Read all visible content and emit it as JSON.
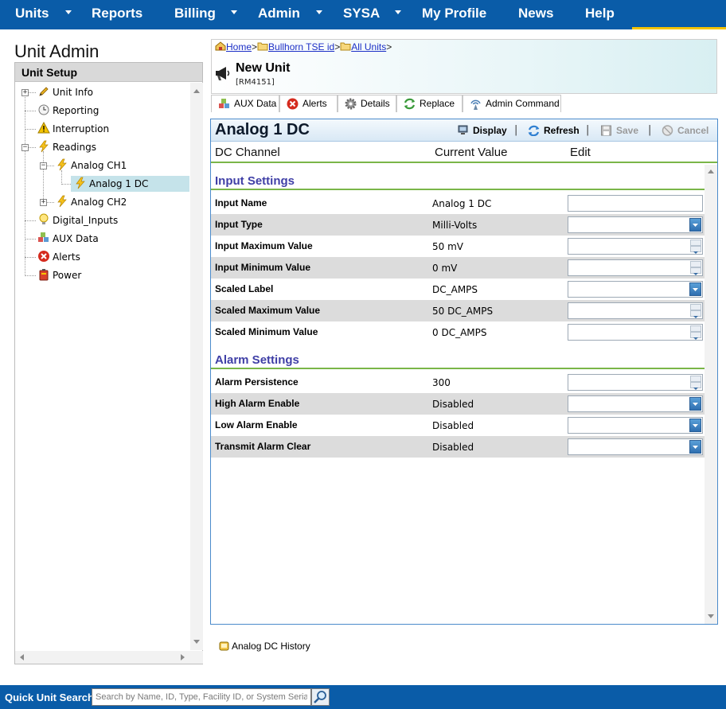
{
  "nav": {
    "items": [
      {
        "label": "Units",
        "has_menu": true
      },
      {
        "label": "Reports",
        "has_menu": false
      },
      {
        "label": "Billing",
        "has_menu": true
      },
      {
        "label": "Admin",
        "has_menu": true
      },
      {
        "label": "SYSA",
        "has_menu": true
      },
      {
        "label": "My Profile",
        "has_menu": false
      },
      {
        "label": "News",
        "has_menu": false
      },
      {
        "label": "Help",
        "has_menu": false
      }
    ],
    "active_underline_color": "#f5c400"
  },
  "left": {
    "page_title": "Unit Admin",
    "panel_title": "Unit Setup",
    "tree": [
      {
        "label": "Unit Info",
        "icon": "pencil-icon"
      },
      {
        "label": "Reporting",
        "icon": "clock-icon"
      },
      {
        "label": "Interruption",
        "icon": "warning-icon"
      },
      {
        "label": "Readings",
        "icon": "lightning-icon"
      },
      {
        "label": "Analog CH1",
        "icon": "lightning-icon"
      },
      {
        "label": "Analog 1 DC",
        "icon": "lightning-icon",
        "selected": true
      },
      {
        "label": "Analog CH2",
        "icon": "lightning-icon"
      },
      {
        "label": "Digital_Inputs",
        "icon": "lightbulb-icon"
      },
      {
        "label": "AUX Data",
        "icon": "cubes-icon"
      },
      {
        "label": "Alerts",
        "icon": "red-x-icon"
      },
      {
        "label": "Power",
        "icon": "battery-icon"
      }
    ]
  },
  "header": {
    "breadcrumb": [
      "Home",
      "Bullhorn TSE id",
      "All Units"
    ],
    "unit_name": "New Unit",
    "unit_code": "[RM4151]"
  },
  "tabs": [
    {
      "label": "AUX Data",
      "icon": "cubes-icon"
    },
    {
      "label": "Alerts",
      "icon": "red-x-icon"
    },
    {
      "label": "Details",
      "icon": "gear-icon"
    },
    {
      "label": "Replace",
      "icon": "refresh-arrows-icon"
    },
    {
      "label": "Admin Command",
      "icon": "antenna-icon"
    }
  ],
  "detail": {
    "title": "Analog 1 DC",
    "buttons": {
      "display": "Display",
      "refresh": "Refresh",
      "save": "Save",
      "cancel": "Cancel"
    },
    "columns": {
      "channel": "DC Channel",
      "current": "Current Value",
      "edit": "Edit"
    },
    "sections": [
      {
        "title": "Input Settings",
        "rows": [
          {
            "label": "Input Name",
            "value": "Analog 1 DC",
            "control": "text"
          },
          {
            "label": "Input Type",
            "value": "Milli-Volts",
            "control": "dropdown"
          },
          {
            "label": "Input Maximum Value",
            "value": "50 mV",
            "control": "spinner"
          },
          {
            "label": "Input Minimum Value",
            "value": "0 mV",
            "control": "spinner"
          },
          {
            "label": "Scaled Label",
            "value": "DC_AMPS",
            "control": "dropdown"
          },
          {
            "label": "Scaled Maximum Value",
            "value": "50 DC_AMPS",
            "control": "spinner"
          },
          {
            "label": "Scaled Minimum Value",
            "value": "0 DC_AMPS",
            "control": "spinner"
          }
        ]
      },
      {
        "title": "Alarm Settings",
        "rows": [
          {
            "label": "Alarm Persistence",
            "value": "300",
            "control": "spinner"
          },
          {
            "label": "High Alarm Enable",
            "value": "Disabled",
            "control": "dropdown"
          },
          {
            "label": "Low Alarm Enable",
            "value": "Disabled",
            "control": "dropdown"
          },
          {
            "label": "Transmit Alarm Clear",
            "value": "Disabled",
            "control": "dropdown"
          }
        ]
      }
    ]
  },
  "history_link": "Analog DC History",
  "quick_search": {
    "label": "Quick Unit Search:",
    "placeholder": "Search by Name, ID, Type, Facility ID, or System Serial"
  }
}
